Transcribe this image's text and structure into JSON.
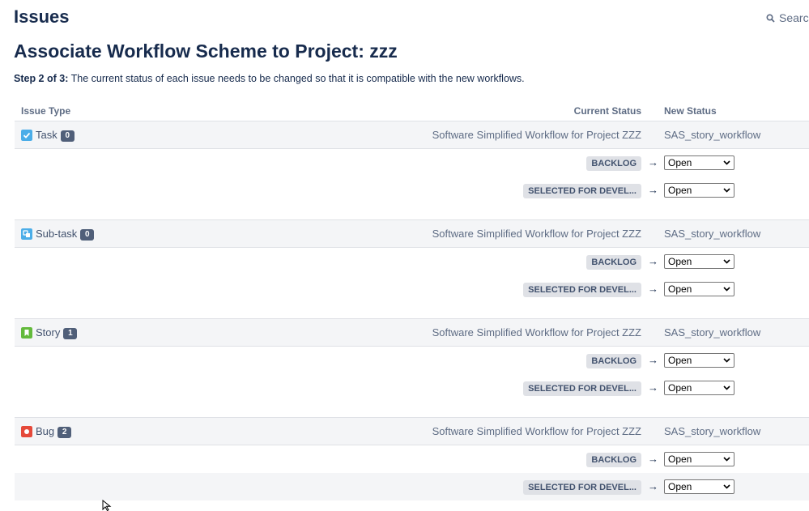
{
  "header": {
    "title": "Issues",
    "search_label": "Search"
  },
  "page": {
    "title": "Associate Workflow Scheme to Project: zzz",
    "step_label": "Step 2 of 3:",
    "step_text": " The current status of each issue needs to be changed so that it is compatible with the new workflows."
  },
  "columns": {
    "issue_type": "Issue Type",
    "current_status": "Current Status",
    "new_status": "New Status"
  },
  "groups": [
    {
      "type": "Task",
      "count": "0",
      "icon": "task-icon",
      "icon_color": "#4bade8",
      "current_workflow": "Software Simplified Workflow for Project ZZZ",
      "new_workflow": "SAS_story_workflow",
      "mappings": [
        {
          "status": "BACKLOG",
          "new_status": "Open"
        },
        {
          "status": "SELECTED FOR DEVEL...",
          "new_status": "Open"
        }
      ]
    },
    {
      "type": "Sub-task",
      "count": "0",
      "icon": "subtask-icon",
      "icon_color": "#4bade8",
      "current_workflow": "Software Simplified Workflow for Project ZZZ",
      "new_workflow": "SAS_story_workflow",
      "mappings": [
        {
          "status": "BACKLOG",
          "new_status": "Open"
        },
        {
          "status": "SELECTED FOR DEVEL...",
          "new_status": "Open"
        }
      ]
    },
    {
      "type": "Story",
      "count": "1",
      "icon": "story-icon",
      "icon_color": "#63ba3c",
      "current_workflow": "Software Simplified Workflow for Project ZZZ",
      "new_workflow": "SAS_story_workflow",
      "mappings": [
        {
          "status": "BACKLOG",
          "new_status": "Open"
        },
        {
          "status": "SELECTED FOR DEVEL...",
          "new_status": "Open"
        }
      ]
    },
    {
      "type": "Bug",
      "count": "2",
      "icon": "bug-icon",
      "icon_color": "#e5493a",
      "current_workflow": "Software Simplified Workflow for Project ZZZ",
      "new_workflow": "SAS_story_workflow",
      "mappings": [
        {
          "status": "BACKLOG",
          "new_status": "Open"
        },
        {
          "status": "SELECTED FOR DEVEL...",
          "new_status": "Open"
        }
      ]
    }
  ],
  "arrow_symbol": "→"
}
